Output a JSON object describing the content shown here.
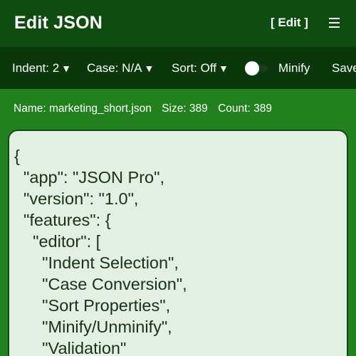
{
  "appbar": {
    "title": "Edit JSON",
    "edit_label": "[ Edit ]",
    "menu_icon": "hamburger-menu-icon"
  },
  "toolbar": {
    "indent_label": "Indent: 2",
    "case_label": "Case: N/A",
    "sort_label": "Sort: Off",
    "caret": "▼",
    "minify_label": "Minify",
    "minify_enabled": false,
    "save_label": "Save"
  },
  "file_info": {
    "name": "Name: marketing_short.json",
    "size": "Size: 389",
    "count": "Count: 389"
  },
  "editor": {
    "lines": [
      "{",
      "  \"app\": \"JSON Pro\",",
      "  \"version\": \"1.0\",",
      "  \"features\": {",
      "    \"editor\": [",
      "      \"Indent Selection\",",
      "      \"Case Conversion\",",
      "      \"Sort Properties\",",
      "      \"Minify/Unminify\",",
      "      \"Validation\""
    ]
  },
  "colors": {
    "appbar_bg": "#0f4c0f",
    "toolbar_bg": "#0b380b",
    "page_bg": "#22801f",
    "editor_bg": "#e3efe3"
  }
}
